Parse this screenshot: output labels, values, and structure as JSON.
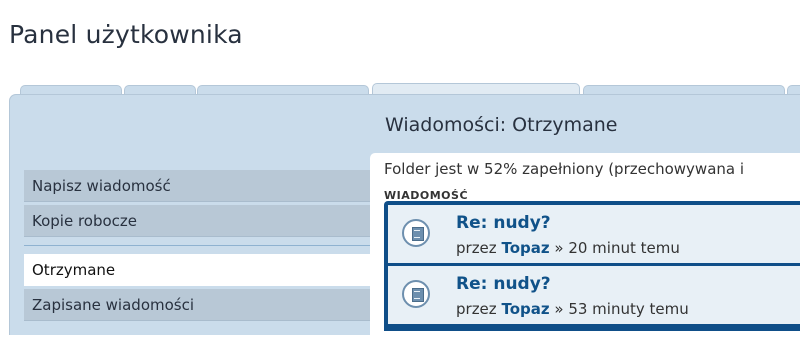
{
  "page": {
    "title": "Panel użytkownika"
  },
  "panel": {
    "title": "Wiadomości: Otrzymane"
  },
  "menu": {
    "items": [
      {
        "label": "Napisz wiadomość"
      },
      {
        "label": "Kopie robocze"
      },
      {
        "label": "Otrzymane"
      },
      {
        "label": "Zapisane wiadomości"
      }
    ],
    "active": "Otrzymane"
  },
  "folder": {
    "info": "Folder jest w 52% zapełniony (przechowywana i",
    "list_header": "WIADOMOŚĆ"
  },
  "messages": [
    {
      "title": "Re: nudy?",
      "prefix": "przez",
      "author": "Topaz",
      "time": "» 20 minut temu"
    },
    {
      "title": "Re: nudy?",
      "prefix": "przez",
      "author": "Topaz",
      "time": "» 53 minuty temu"
    }
  ]
}
